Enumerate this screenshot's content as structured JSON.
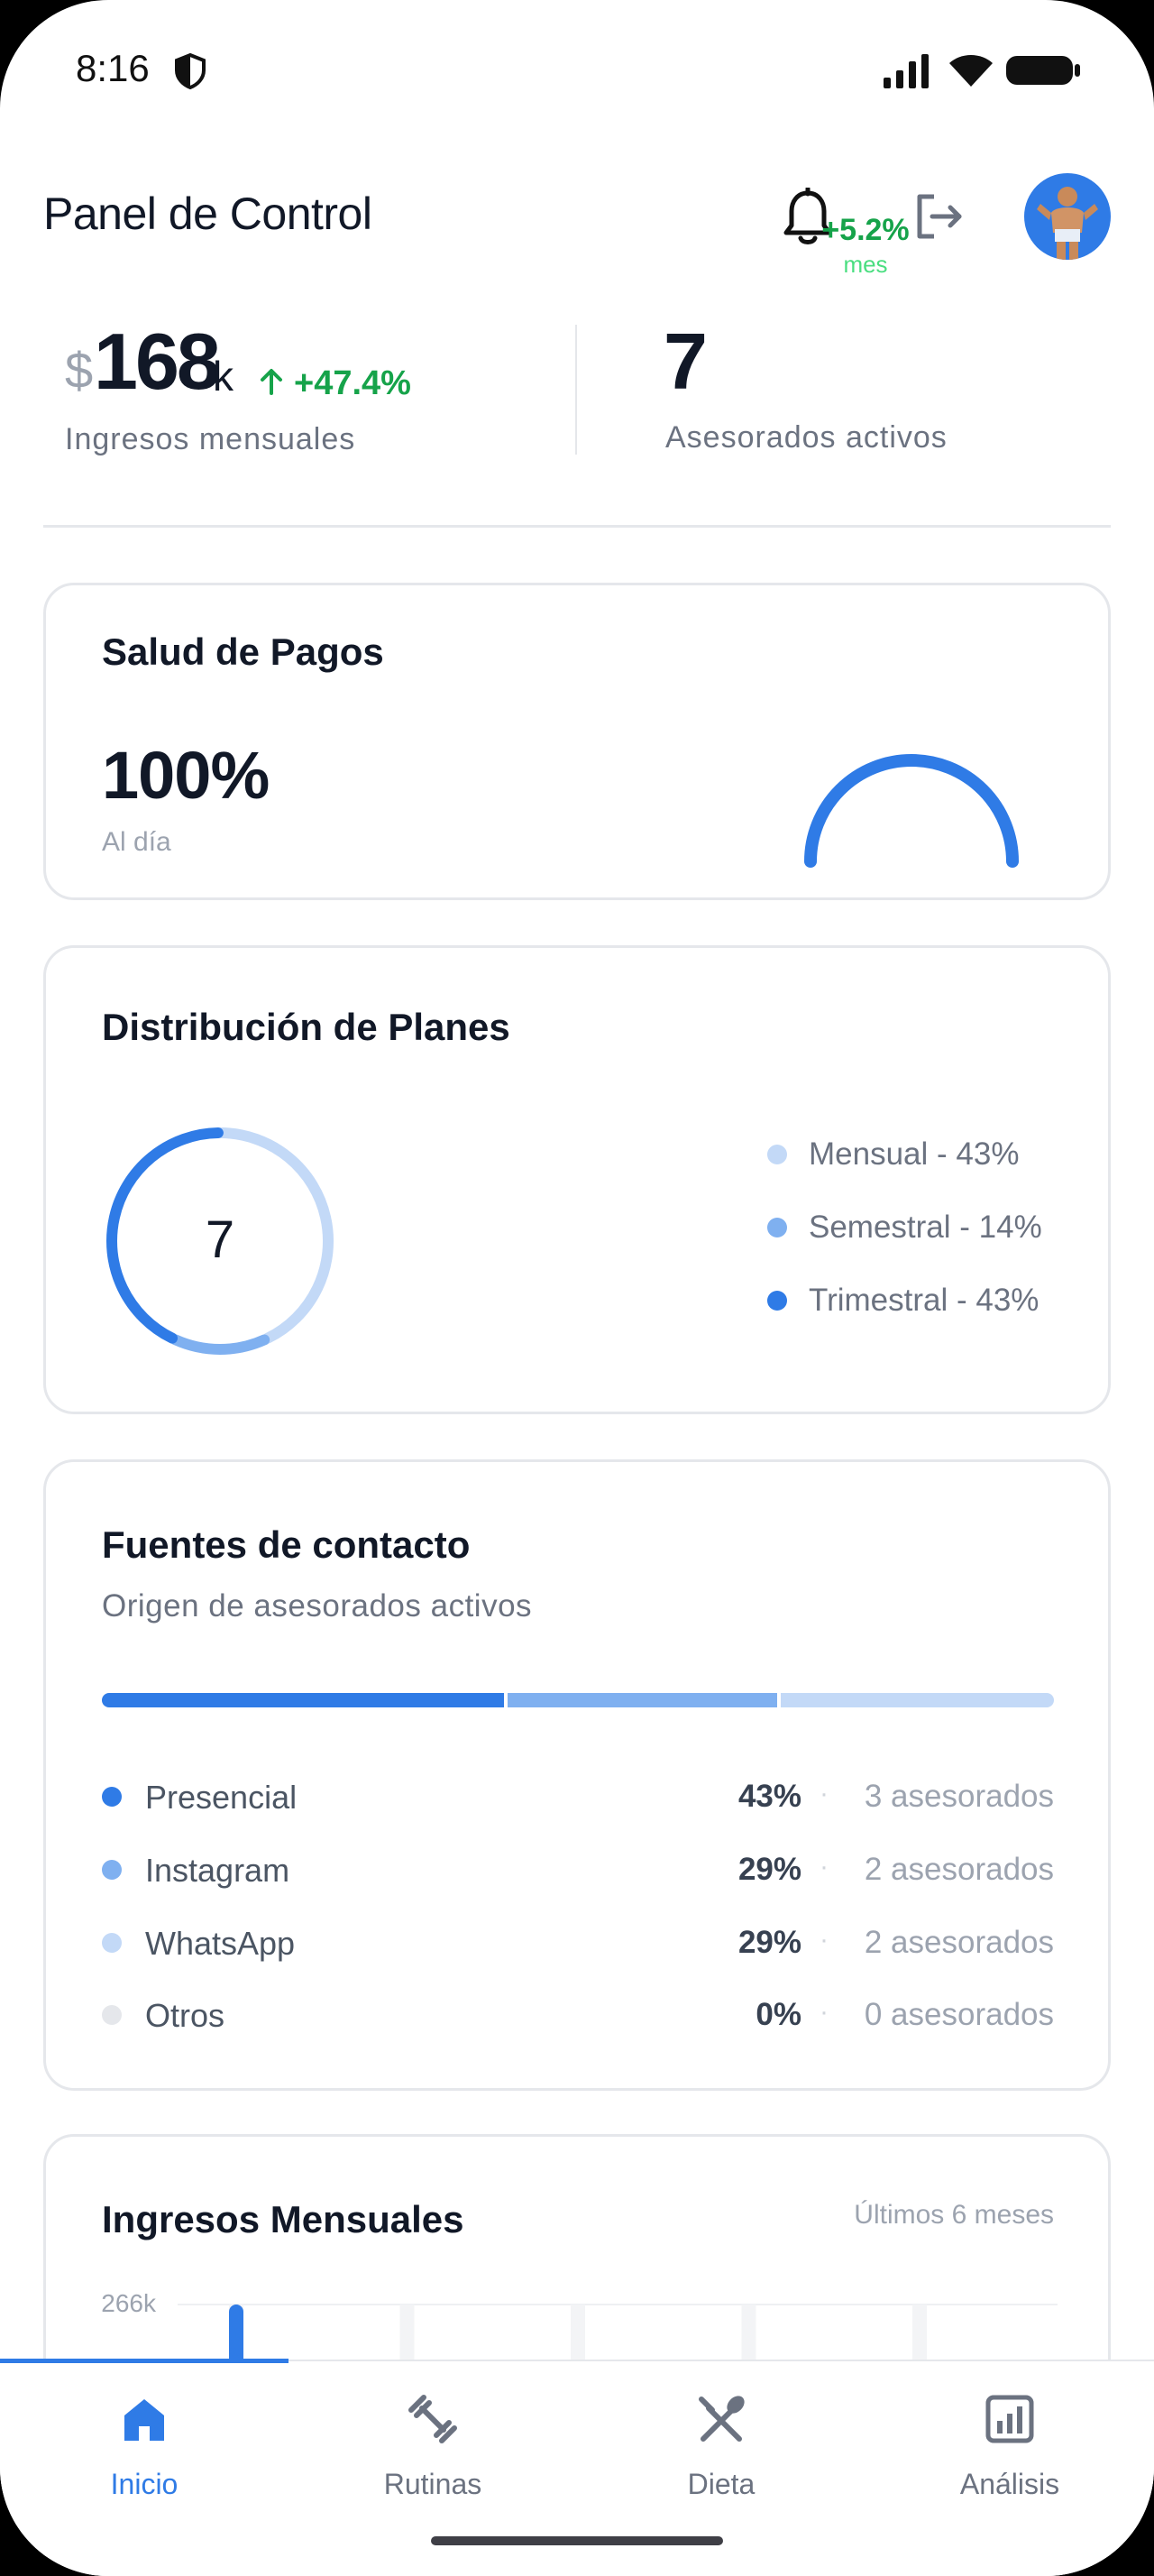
{
  "status_bar": {
    "time": "8:16"
  },
  "header": {
    "title": "Panel de Control"
  },
  "kpis": {
    "revenue_currency": "$",
    "revenue_value": "168",
    "revenue_suffix": "k",
    "revenue_change": "+47.4%",
    "revenue_label": "Ingresos mensuales",
    "active_count": "7",
    "active_label": "Asesorados activos"
  },
  "salud": {
    "title": "Salud de Pagos",
    "value": "100%",
    "subtitle": "Al día",
    "gauge_change": "+5.2%",
    "gauge_unit": "mes",
    "gauge_fraction": 1.0
  },
  "distribucion": {
    "title": "Distribución de Planes",
    "total": "7",
    "legend": [
      {
        "label": "Mensual - 43%",
        "color": "#c3d9f7",
        "share": 0.43
      },
      {
        "label": "Semestral - 14%",
        "color": "#7fb0f0",
        "share": 0.14
      },
      {
        "label": "Trimestral - 43%",
        "color": "#2f7be6",
        "share": 0.43
      }
    ]
  },
  "fuentes": {
    "title": "Fuentes de contacto",
    "subtitle": "Origen de asesorados activos",
    "separator": "·",
    "sources": [
      {
        "name": "Presencial",
        "pct": "43%",
        "count": "3 asesorados",
        "share": 0.43,
        "color": "#2f7be6"
      },
      {
        "name": "Instagram",
        "pct": "29%",
        "count": "2 asesorados",
        "share": 0.29,
        "color": "#7fb0f0"
      },
      {
        "name": "WhatsApp",
        "pct": "29%",
        "count": "2 asesorados",
        "share": 0.29,
        "color": "#c3d9f7"
      },
      {
        "name": "Otros",
        "pct": "0%",
        "count": "0 asesorados",
        "share": 0.0,
        "color": "#e5e7eb"
      }
    ]
  },
  "ingresos": {
    "title": "Ingresos Mensuales",
    "range": "Últimos 6 meses"
  },
  "chart_data": {
    "type": "bar",
    "title": "Ingresos Mensuales",
    "subtitle": "Últimos 6 meses",
    "y_tick_labels": [
      "266k"
    ],
    "ylim": [
      0,
      266
    ],
    "visible_bar_tops_relative_to_max": [
      1.0,
      0,
      0,
      0,
      0.15,
      1.0
    ],
    "bar_color": "#2f7be6",
    "track_color": "#f3f4f6"
  },
  "bottom_nav": {
    "items": [
      {
        "label": "Inicio",
        "icon": "home-icon",
        "active": true
      },
      {
        "label": "Rutinas",
        "icon": "dumbbell-icon",
        "active": false
      },
      {
        "label": "Dieta",
        "icon": "fork-knife-icon",
        "active": false
      },
      {
        "label": "Análisis",
        "icon": "chart-icon",
        "active": false
      }
    ]
  },
  "colors": {
    "accent": "#2f7be6",
    "positive": "#16a34a",
    "text_primary": "#111827",
    "text_secondary": "#6b7280"
  }
}
